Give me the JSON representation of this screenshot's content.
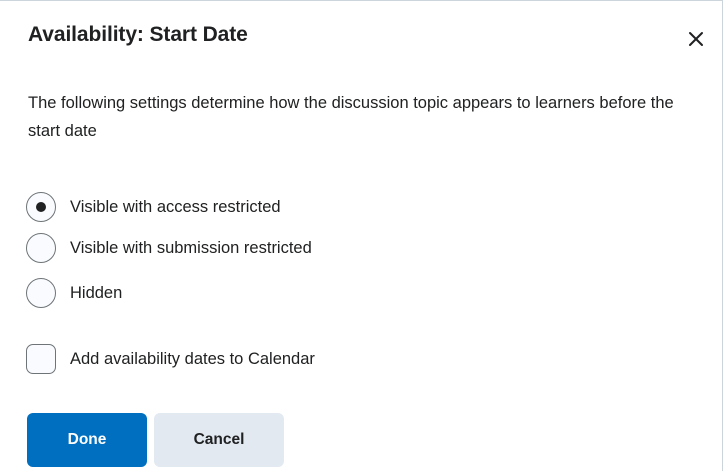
{
  "dialog": {
    "title": "Availability: Start Date",
    "close_icon": "close-icon",
    "description": "The following settings determine how the discussion topic appears to learners before the start date"
  },
  "options": [
    {
      "label": "Visible with access restricted",
      "selected": true
    },
    {
      "label": "Visible with submission restricted",
      "selected": false
    },
    {
      "label": "Hidden",
      "selected": false
    }
  ],
  "calendar_checkbox": {
    "label": "Add availability dates to Calendar",
    "checked": false
  },
  "buttons": {
    "done_label": "Done",
    "cancel_label": "Cancel"
  },
  "colors": {
    "primary": "#006fbf",
    "secondary": "#e3e9f1",
    "text": "#202122"
  }
}
